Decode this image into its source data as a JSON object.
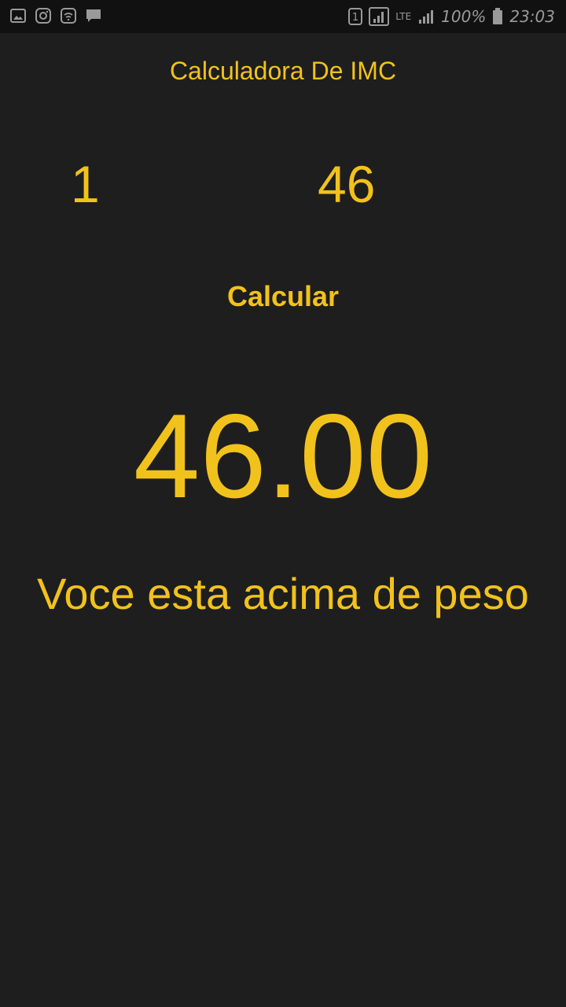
{
  "status_bar": {
    "sim_slot": "1",
    "network": "LTE",
    "battery": "100%",
    "time": "23:03"
  },
  "app": {
    "title": "Calculadora De IMC",
    "height_value": "1",
    "weight_value": "46",
    "calculate_label": "Calcular",
    "result_value": "46.00",
    "result_message": "Voce esta acima de peso"
  },
  "colors": {
    "accent": "#f2c21c",
    "background": "#1e1e1e",
    "status_bar": "#111111"
  }
}
